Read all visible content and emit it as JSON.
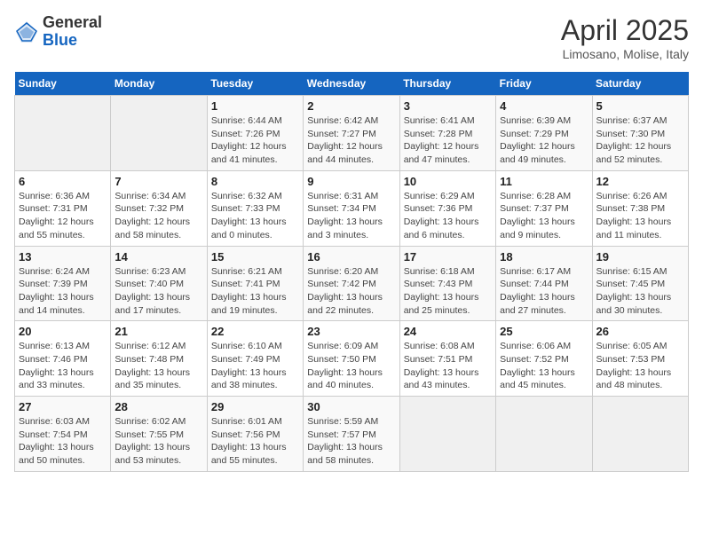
{
  "logo": {
    "general": "General",
    "blue": "Blue"
  },
  "title": "April 2025",
  "subtitle": "Limosano, Molise, Italy",
  "header_days": [
    "Sunday",
    "Monday",
    "Tuesday",
    "Wednesday",
    "Thursday",
    "Friday",
    "Saturday"
  ],
  "weeks": [
    [
      {
        "day": "",
        "info": ""
      },
      {
        "day": "",
        "info": ""
      },
      {
        "day": "1",
        "info": "Sunrise: 6:44 AM\nSunset: 7:26 PM\nDaylight: 12 hours and 41 minutes."
      },
      {
        "day": "2",
        "info": "Sunrise: 6:42 AM\nSunset: 7:27 PM\nDaylight: 12 hours and 44 minutes."
      },
      {
        "day": "3",
        "info": "Sunrise: 6:41 AM\nSunset: 7:28 PM\nDaylight: 12 hours and 47 minutes."
      },
      {
        "day": "4",
        "info": "Sunrise: 6:39 AM\nSunset: 7:29 PM\nDaylight: 12 hours and 49 minutes."
      },
      {
        "day": "5",
        "info": "Sunrise: 6:37 AM\nSunset: 7:30 PM\nDaylight: 12 hours and 52 minutes."
      }
    ],
    [
      {
        "day": "6",
        "info": "Sunrise: 6:36 AM\nSunset: 7:31 PM\nDaylight: 12 hours and 55 minutes."
      },
      {
        "day": "7",
        "info": "Sunrise: 6:34 AM\nSunset: 7:32 PM\nDaylight: 12 hours and 58 minutes."
      },
      {
        "day": "8",
        "info": "Sunrise: 6:32 AM\nSunset: 7:33 PM\nDaylight: 13 hours and 0 minutes."
      },
      {
        "day": "9",
        "info": "Sunrise: 6:31 AM\nSunset: 7:34 PM\nDaylight: 13 hours and 3 minutes."
      },
      {
        "day": "10",
        "info": "Sunrise: 6:29 AM\nSunset: 7:36 PM\nDaylight: 13 hours and 6 minutes."
      },
      {
        "day": "11",
        "info": "Sunrise: 6:28 AM\nSunset: 7:37 PM\nDaylight: 13 hours and 9 minutes."
      },
      {
        "day": "12",
        "info": "Sunrise: 6:26 AM\nSunset: 7:38 PM\nDaylight: 13 hours and 11 minutes."
      }
    ],
    [
      {
        "day": "13",
        "info": "Sunrise: 6:24 AM\nSunset: 7:39 PM\nDaylight: 13 hours and 14 minutes."
      },
      {
        "day": "14",
        "info": "Sunrise: 6:23 AM\nSunset: 7:40 PM\nDaylight: 13 hours and 17 minutes."
      },
      {
        "day": "15",
        "info": "Sunrise: 6:21 AM\nSunset: 7:41 PM\nDaylight: 13 hours and 19 minutes."
      },
      {
        "day": "16",
        "info": "Sunrise: 6:20 AM\nSunset: 7:42 PM\nDaylight: 13 hours and 22 minutes."
      },
      {
        "day": "17",
        "info": "Sunrise: 6:18 AM\nSunset: 7:43 PM\nDaylight: 13 hours and 25 minutes."
      },
      {
        "day": "18",
        "info": "Sunrise: 6:17 AM\nSunset: 7:44 PM\nDaylight: 13 hours and 27 minutes."
      },
      {
        "day": "19",
        "info": "Sunrise: 6:15 AM\nSunset: 7:45 PM\nDaylight: 13 hours and 30 minutes."
      }
    ],
    [
      {
        "day": "20",
        "info": "Sunrise: 6:13 AM\nSunset: 7:46 PM\nDaylight: 13 hours and 33 minutes."
      },
      {
        "day": "21",
        "info": "Sunrise: 6:12 AM\nSunset: 7:48 PM\nDaylight: 13 hours and 35 minutes."
      },
      {
        "day": "22",
        "info": "Sunrise: 6:10 AM\nSunset: 7:49 PM\nDaylight: 13 hours and 38 minutes."
      },
      {
        "day": "23",
        "info": "Sunrise: 6:09 AM\nSunset: 7:50 PM\nDaylight: 13 hours and 40 minutes."
      },
      {
        "day": "24",
        "info": "Sunrise: 6:08 AM\nSunset: 7:51 PM\nDaylight: 13 hours and 43 minutes."
      },
      {
        "day": "25",
        "info": "Sunrise: 6:06 AM\nSunset: 7:52 PM\nDaylight: 13 hours and 45 minutes."
      },
      {
        "day": "26",
        "info": "Sunrise: 6:05 AM\nSunset: 7:53 PM\nDaylight: 13 hours and 48 minutes."
      }
    ],
    [
      {
        "day": "27",
        "info": "Sunrise: 6:03 AM\nSunset: 7:54 PM\nDaylight: 13 hours and 50 minutes."
      },
      {
        "day": "28",
        "info": "Sunrise: 6:02 AM\nSunset: 7:55 PM\nDaylight: 13 hours and 53 minutes."
      },
      {
        "day": "29",
        "info": "Sunrise: 6:01 AM\nSunset: 7:56 PM\nDaylight: 13 hours and 55 minutes."
      },
      {
        "day": "30",
        "info": "Sunrise: 5:59 AM\nSunset: 7:57 PM\nDaylight: 13 hours and 58 minutes."
      },
      {
        "day": "",
        "info": ""
      },
      {
        "day": "",
        "info": ""
      },
      {
        "day": "",
        "info": ""
      }
    ]
  ]
}
